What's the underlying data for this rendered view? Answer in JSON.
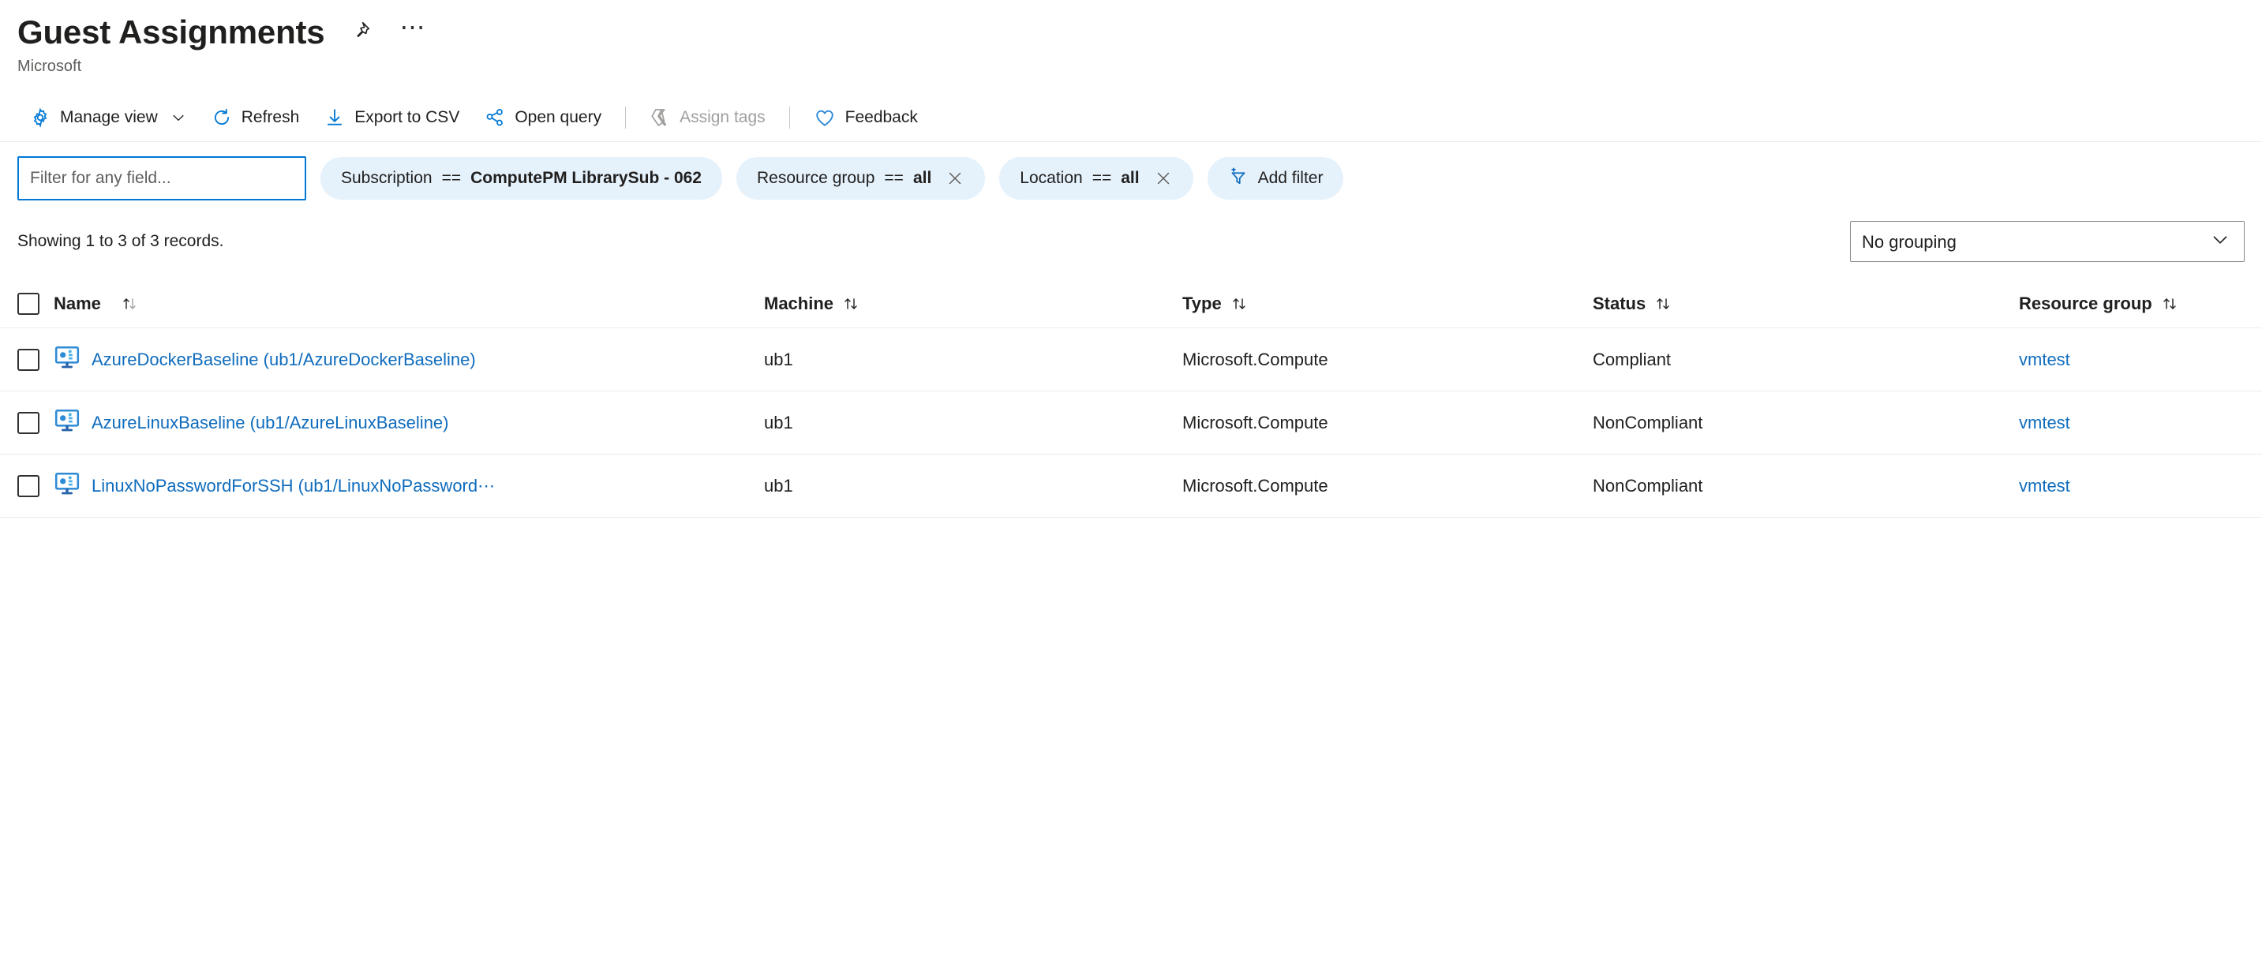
{
  "header": {
    "title": "Guest Assignments",
    "subtitle": "Microsoft",
    "pin_icon": "pin-icon",
    "more_icon": "ellipsis-icon"
  },
  "toolbar": {
    "items": [
      {
        "label": "Manage view",
        "icon": "gear-icon",
        "has_chevron": true,
        "disabled": false
      },
      {
        "label": "Refresh",
        "icon": "refresh-icon",
        "has_chevron": false,
        "disabled": false
      },
      {
        "label": "Export to CSV",
        "icon": "download-icon",
        "has_chevron": false,
        "disabled": false
      },
      {
        "label": "Open query",
        "icon": "query-graph-icon",
        "has_chevron": false,
        "disabled": false
      },
      {
        "label": "Assign tags",
        "icon": "tag-icon",
        "has_chevron": false,
        "disabled": true
      },
      {
        "label": "Feedback",
        "icon": "heart-icon",
        "has_chevron": false,
        "disabled": false
      }
    ]
  },
  "filters": {
    "search_placeholder": "Filter for any field...",
    "search_value": "",
    "pills": [
      {
        "field": "Subscription",
        "operator": "==",
        "value": "ComputePM LibrarySub - 062",
        "removable": false
      },
      {
        "field": "Resource group",
        "operator": "==",
        "value": "all",
        "removable": true
      },
      {
        "field": "Location",
        "operator": "==",
        "value": "all",
        "removable": true
      }
    ],
    "add_filter_label": "Add filter",
    "add_filter_icon": "add-filter-icon"
  },
  "results": {
    "showing_text": "Showing 1 to 3 of 3 records.",
    "grouping_value": "No grouping",
    "grouping_options": [
      "No grouping"
    ]
  },
  "table": {
    "columns": [
      {
        "key": "name",
        "label": "Name",
        "sortable": true
      },
      {
        "key": "machine",
        "label": "Machine",
        "sortable": true
      },
      {
        "key": "type",
        "label": "Type",
        "sortable": true
      },
      {
        "key": "status",
        "label": "Status",
        "sortable": true
      },
      {
        "key": "resource_group",
        "label": "Resource group",
        "sortable": true
      }
    ],
    "rows": [
      {
        "name": "AzureDockerBaseline (ub1/AzureDockerBaseline)",
        "machine": "ub1",
        "type": "Microsoft.Compute",
        "status": "Compliant",
        "resource_group": "vmtest",
        "icon": "guest-assignment-monitor-icon",
        "selected": false
      },
      {
        "name": "AzureLinuxBaseline (ub1/AzureLinuxBaseline)",
        "machine": "ub1",
        "type": "Microsoft.Compute",
        "status": "NonCompliant",
        "resource_group": "vmtest",
        "icon": "guest-assignment-monitor-icon",
        "selected": false
      },
      {
        "name": "LinuxNoPasswordForSSH (ub1/LinuxNoPassword⋯",
        "machine": "ub1",
        "type": "Microsoft.Compute",
        "status": "NonCompliant",
        "resource_group": "vmtest",
        "icon": "guest-assignment-monitor-icon",
        "selected": false
      }
    ]
  },
  "colors": {
    "accent": "#0078d4",
    "link": "#0f6cbd",
    "pill_bg": "#e5f1fb",
    "text": "#201f1e",
    "muted": "#605e5c",
    "disabled": "#a19f9d",
    "border": "#edebe9"
  }
}
